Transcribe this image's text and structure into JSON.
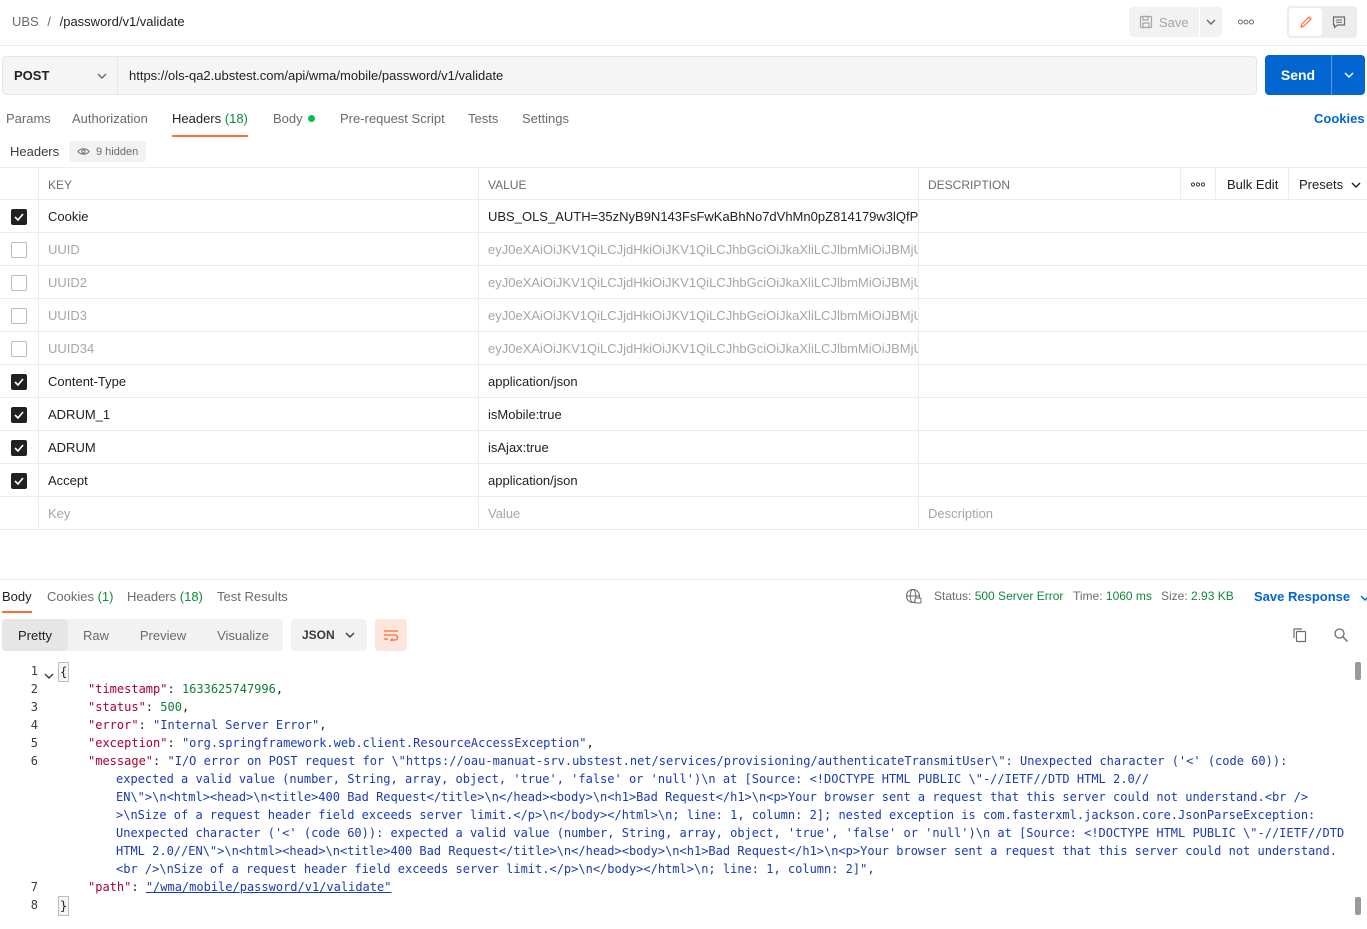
{
  "breadcrumb": {
    "workspace": "UBS",
    "separator": "/",
    "request": "/password/v1/validate"
  },
  "toolbar": {
    "save_label": "Save",
    "more_label": "ooo"
  },
  "request": {
    "method": "POST",
    "url": "https://ols-qa2.ubstest.com/api/wma/mobile/password/v1/validate",
    "send_label": "Send"
  },
  "tabs": {
    "params": "Params",
    "authorization": "Authorization",
    "headers": "Headers",
    "headers_count": "(18)",
    "body": "Body",
    "prerequest": "Pre-request Script",
    "tests": "Tests",
    "settings": "Settings",
    "cookies": "Cookies"
  },
  "headers_panel": {
    "label": "Headers",
    "hidden": "9 hidden",
    "col_key": "KEY",
    "col_value": "VALUE",
    "col_description": "DESCRIPTION",
    "bulk_edit": "Bulk Edit",
    "presets": "Presets",
    "placeholder_key": "Key",
    "placeholder_value": "Value",
    "placeholder_description": "Description"
  },
  "header_rows": [
    {
      "checked": true,
      "key": "Cookie",
      "value": "UBS_OLS_AUTH=35zNyB9N143FsFwKaBhNo7dVhMn0pZ814179w3lQfP1..."
    },
    {
      "checked": false,
      "key": "UUID",
      "value": "eyJ0eXAiOiJKV1QiLCJjdHkiOiJKV1QiLCJhbGciOiJkaXliLCJlbmMiOiJBMjU..."
    },
    {
      "checked": false,
      "key": "UUID2",
      "value": "eyJ0eXAiOiJKV1QiLCJjdHkiOiJKV1QiLCJhbGciOiJkaXliLCJlbmMiOiJBMjU..."
    },
    {
      "checked": false,
      "key": "UUID3",
      "value": "eyJ0eXAiOiJKV1QiLCJjdHkiOiJKV1QiLCJhbGciOiJkaXliLCJlbmMiOiJBMjU..."
    },
    {
      "checked": false,
      "key": "UUID34",
      "value": "eyJ0eXAiOiJKV1QiLCJjdHkiOiJKV1QiLCJhbGciOiJkaXliLCJlbmMiOiJBMjU..."
    },
    {
      "checked": true,
      "key": "Content-Type",
      "value": "application/json"
    },
    {
      "checked": true,
      "key": "ADRUM_1",
      "value": "isMobile:true"
    },
    {
      "checked": true,
      "key": "ADRUM",
      "value": "isAjax:true"
    },
    {
      "checked": true,
      "key": "Accept",
      "value": "application/json"
    }
  ],
  "response": {
    "tabs": {
      "body": "Body",
      "cookies": "Cookies",
      "cookies_count": "(1)",
      "headers": "Headers",
      "headers_count": "(18)",
      "test_results": "Test Results"
    },
    "status_label": "Status:",
    "status_value": "500 Server Error",
    "time_label": "Time:",
    "time_value": "1060 ms",
    "size_label": "Size:",
    "size_value": "2.93 KB",
    "save_response": "Save Response",
    "views": [
      "Pretty",
      "Raw",
      "Preview",
      "Visualize"
    ],
    "format": "JSON"
  },
  "json_body": {
    "open": "{",
    "close": "}",
    "l2k": "\"timestamp\"",
    "l2v": "1633625747996",
    "l3k": "\"status\"",
    "l3v": "500",
    "l4k": "\"error\"",
    "l4v": "\"Internal Server Error\"",
    "l5k": "\"exception\"",
    "l5v": "\"org.springframework.web.client.ResourceAccessException\"",
    "l6k": "\"message\"",
    "msg": [
      "\"I/O error on POST request for \\\"https://oau-manuat-srv.ubstest.net/services/provisioning/authenticateTransmitUser\\\": Unexpected character ('<' (code 60)):",
      "expected a valid value (number, String, array, object, 'true', 'false' or 'null')\\n at [Source: <!DOCTYPE HTML PUBLIC \\\"-//IETF//DTD HTML 2.0//",
      "EN\\\">\\n<html><head>\\n<title>400 Bad Request</title>\\n</head><body>\\n<h1>Bad Request</h1>\\n<p>Your browser sent a request that this server could not understand.<br />",
      ">\\nSize of a request header field exceeds server limit.</p>\\n</body></html>\\n; line: 1, column: 2]; nested exception is com.fasterxml.jackson.core.JsonParseException:",
      "Unexpected character ('<' (code 60)): expected a valid value (number, String, array, object, 'true', 'false' or 'null')\\n at [Source: <!DOCTYPE HTML PUBLIC \\\"-//IETF//DTD",
      "HTML 2.0//EN\\\">\\n<html><head>\\n<title>400 Bad Request</title>\\n</head><body>\\n<h1>Bad Request</h1>\\n<p>Your browser sent a request that this server could not understand.",
      "<br />\\nSize of a request header field exceeds server limit.</p>\\n</body></html>\\n; line: 1, column: 2]\","
    ],
    "l7k": "\"path\"",
    "l7v": "\"/wma/mobile/password/v1/validate\"",
    "line_numbers": [
      "1",
      "2",
      "3",
      "4",
      "5",
      "6",
      "7",
      "8"
    ]
  },
  "colors": {
    "accent": "#ff6c37",
    "primary": "#0265d2",
    "success": "#0e8a3a"
  }
}
